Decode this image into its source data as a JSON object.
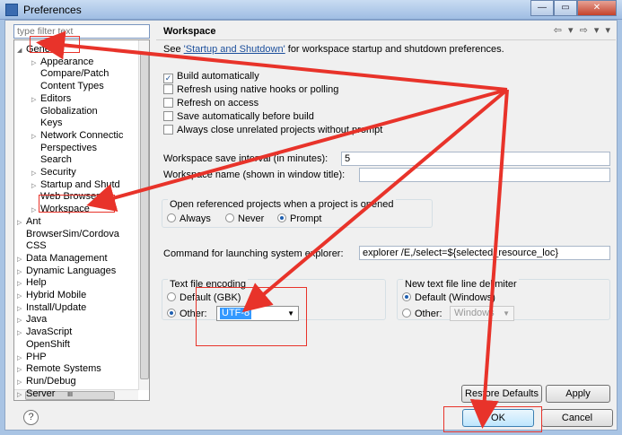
{
  "window": {
    "title": "Preferences",
    "controls": [
      "—",
      "▭",
      "✕"
    ]
  },
  "left": {
    "filter_placeholder": "type filter text",
    "tree": [
      {
        "label": "General",
        "toggle": "◢",
        "indent": 0
      },
      {
        "label": "Appearance",
        "toggle": "▷",
        "indent": 1
      },
      {
        "label": "Compare/Patch",
        "toggle": "",
        "indent": 1
      },
      {
        "label": "Content Types",
        "toggle": "",
        "indent": 1
      },
      {
        "label": "Editors",
        "toggle": "▷",
        "indent": 1
      },
      {
        "label": "Globalization",
        "toggle": "",
        "indent": 1
      },
      {
        "label": "Keys",
        "toggle": "",
        "indent": 1
      },
      {
        "label": "Network Connectic",
        "toggle": "▷",
        "indent": 1
      },
      {
        "label": "Perspectives",
        "toggle": "",
        "indent": 1
      },
      {
        "label": "Search",
        "toggle": "",
        "indent": 1
      },
      {
        "label": "Security",
        "toggle": "▷",
        "indent": 1
      },
      {
        "label": "Startup and Shutd",
        "toggle": "▷",
        "indent": 1
      },
      {
        "label": "Web Browser",
        "toggle": "",
        "indent": 1
      },
      {
        "label": "Workspace",
        "toggle": "▷",
        "indent": 1
      },
      {
        "label": "Ant",
        "toggle": "▷",
        "indent": 0
      },
      {
        "label": "BrowserSim/Cordova",
        "toggle": "",
        "indent": 0
      },
      {
        "label": "CSS",
        "toggle": "",
        "indent": 0
      },
      {
        "label": "Data Management",
        "toggle": "▷",
        "indent": 0
      },
      {
        "label": "Dynamic Languages",
        "toggle": "▷",
        "indent": 0
      },
      {
        "label": "Help",
        "toggle": "▷",
        "indent": 0
      },
      {
        "label": "Hybrid Mobile",
        "toggle": "▷",
        "indent": 0
      },
      {
        "label": "Install/Update",
        "toggle": "▷",
        "indent": 0
      },
      {
        "label": "Java",
        "toggle": "▷",
        "indent": 0
      },
      {
        "label": "JavaScript",
        "toggle": "▷",
        "indent": 0
      },
      {
        "label": "OpenShift",
        "toggle": "",
        "indent": 0
      },
      {
        "label": "PHP",
        "toggle": "▷",
        "indent": 0
      },
      {
        "label": "Remote Systems",
        "toggle": "▷",
        "indent": 0
      },
      {
        "label": "Run/Debug",
        "toggle": "▷",
        "indent": 0
      },
      {
        "label": "Server",
        "toggle": "▷",
        "indent": 0
      }
    ],
    "hscroll_grip": "III"
  },
  "right": {
    "title": "Workspace",
    "nav_icons": "⇦ ▾ ⇨ ▾ ▾",
    "see_prefix": "See ",
    "see_link": "'Startup and Shutdown'",
    "see_suffix": " for workspace startup and shutdown preferences.",
    "checkboxes": [
      {
        "label": "Build automatically",
        "checked": true,
        "mark": "✓"
      },
      {
        "label": "Refresh using native hooks or polling",
        "checked": false,
        "mark": ""
      },
      {
        "label": "Refresh on access",
        "checked": false,
        "mark": ""
      },
      {
        "label": "Save automatically before build",
        "checked": false,
        "mark": ""
      },
      {
        "label": "Always close unrelated projects without prompt",
        "checked": false,
        "mark": ""
      }
    ],
    "save_interval_label": "Workspace save interval (in minutes):",
    "save_interval_value": "5",
    "workspace_name_label": "Workspace name (shown in window title):",
    "workspace_name_value": "",
    "open_ref_group": {
      "title": "Open referenced projects when a project is opened",
      "options": [
        "Always",
        "Never",
        "Prompt"
      ],
      "selected": "Prompt"
    },
    "explorer_label": "Command for launching system explorer:",
    "explorer_value": "explorer /E,/select=${selected_resource_loc}",
    "encoding_group": {
      "title": "Text file encoding",
      "default_label": "Default (GBK)",
      "other_label": "Other:",
      "other_value": "UTF-8",
      "selected": "Other"
    },
    "delimiter_group": {
      "title": "New text file line delimiter",
      "default_label": "Default (Windows)",
      "other_label": "Other:",
      "other_value": "Windows",
      "selected": "Default"
    },
    "restore_defaults": "Restore Defaults",
    "apply": "Apply"
  },
  "bottom": {
    "help": "?",
    "ok": "OK",
    "cancel": "Cancel"
  },
  "annotation_color": "#e8332a"
}
